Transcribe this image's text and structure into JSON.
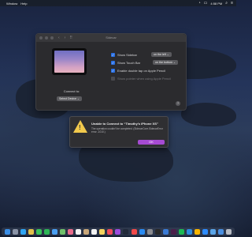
{
  "menubar": {
    "menu_item": "Window",
    "help_label": "Help",
    "clock": "4:58 PM"
  },
  "window": {
    "title": "Sidecar",
    "connect_label": "Connect to:",
    "connect_select": "Select Device",
    "options": [
      {
        "label": "Show Sidebar",
        "checked": true,
        "select": "on the left",
        "disabled": false
      },
      {
        "label": "Show Touch Bar",
        "checked": true,
        "select": "on the bottom",
        "disabled": false
      },
      {
        "label": "Enable double tap on Apple Pencil",
        "checked": true,
        "select": "",
        "disabled": false
      },
      {
        "label": "Show pointer when using Apple Pencil",
        "checked": false,
        "select": "",
        "disabled": true
      }
    ],
    "help_label": "?"
  },
  "alert": {
    "title": "Unable to Connect to “Timothy’s iPhone XS”",
    "message": "The operation couldn’t be completed. (SidecarCore.SidecarError error -1010.)",
    "ok_label": "OK"
  },
  "colors": {
    "accent": "#2a71e6",
    "ok_button": "#a64bd3",
    "warning": "#f2c94c"
  },
  "dock": {
    "apps": [
      {
        "name": "finder-icon",
        "color": "#3a8ee6"
      },
      {
        "name": "launchpad-icon",
        "color": "#8a93a6"
      },
      {
        "name": "safari-icon",
        "color": "#2fa4f2"
      },
      {
        "name": "chrome-icon",
        "color": "#e2c04a"
      },
      {
        "name": "messages-icon",
        "color": "#39c25a"
      },
      {
        "name": "facetime-icon",
        "color": "#2db556"
      },
      {
        "name": "mail-icon",
        "color": "#4a9ff2"
      },
      {
        "name": "maps-icon",
        "color": "#6fbf6a"
      },
      {
        "name": "photos-icon",
        "color": "#e96b8b"
      },
      {
        "name": "calendar-icon",
        "color": "#f2f2f2"
      },
      {
        "name": "contacts-icon",
        "color": "#c9a77a"
      },
      {
        "name": "reminders-icon",
        "color": "#f2f2f2"
      },
      {
        "name": "notes-icon",
        "color": "#f4d35e"
      },
      {
        "name": "music-icon",
        "color": "#f04a5a"
      },
      {
        "name": "podcasts-icon",
        "color": "#9b4bdc"
      },
      {
        "name": "tv-icon",
        "color": "#222a3a"
      },
      {
        "name": "news-icon",
        "color": "#f24a4a"
      },
      {
        "name": "appstore-icon",
        "color": "#2a8bf2"
      },
      {
        "name": "preferences-icon",
        "color": "#8c8c90"
      },
      {
        "name": "terminal-icon",
        "color": "#2a2a2a"
      },
      {
        "name": "xcode-icon",
        "color": "#3a7bd5"
      },
      {
        "name": "slack-icon",
        "color": "#4a1f4a"
      },
      {
        "name": "spotify-icon",
        "color": "#1db954"
      },
      {
        "name": "vscode-icon",
        "color": "#2d8ce0"
      },
      {
        "name": "sketch-icon",
        "color": "#f7b500"
      },
      {
        "name": "zoom-icon",
        "color": "#2d8cff"
      },
      {
        "name": "finder-folder-icon",
        "color": "#5aa5e8"
      },
      {
        "name": "downloads-icon",
        "color": "#4a8fe0"
      },
      {
        "name": "trash-icon",
        "color": "#b8bcc4"
      }
    ]
  }
}
